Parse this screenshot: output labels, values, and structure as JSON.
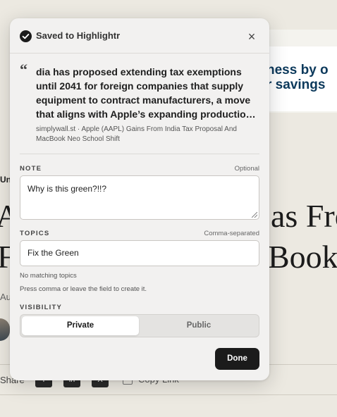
{
  "background": {
    "banner_line1": "ness by o",
    "banner_line2": "r savings",
    "category_fragment": "Uni",
    "title_line1_left": "A",
    "title_line1_right": "as Fro",
    "title_line2_left": "F",
    "title_line2_right": "Book",
    "author_fragment": "Au",
    "share_label": "Share",
    "share_buttons": [
      "f",
      "in",
      "X"
    ],
    "copy_link": "Copy Link"
  },
  "modal": {
    "title": "Saved to Highlightr",
    "close_symbol": "×",
    "quote_mark": "“",
    "quote": "dia has proposed extending tax exemptions until 2041 for foreign companies that supply equipment to contract manufacturers, a move that aligns with Apple’s expanding production in India",
    "source": "simplywall.st · Apple (AAPL) Gains From India Tax Proposal And MacBook Neo School Shift",
    "note": {
      "label": "NOTE",
      "hint": "Optional",
      "value": "Why is this green?!!?"
    },
    "topics": {
      "label": "TOPICS",
      "hint": "Comma-separated",
      "value": "Fix the Green",
      "helper_1": "No matching topics",
      "helper_2": "Press comma or leave the field to create it."
    },
    "visibility": {
      "label": "VISIBILITY",
      "options": [
        "Private",
        "Public"
      ],
      "selected": "Private"
    },
    "done_label": "Done"
  },
  "colors": {
    "page_bg": "#ece9e1",
    "card_bg": "#f2f1f0",
    "primary_dark": "#1b1b1b",
    "banner_text": "#0d3a5c"
  },
  "icons": {
    "header_status": "check-circle-icon",
    "close": "close-icon",
    "quote": "quote-mark-icon",
    "resize": "resize-grip-icon",
    "copy": "copy-link-icon"
  }
}
